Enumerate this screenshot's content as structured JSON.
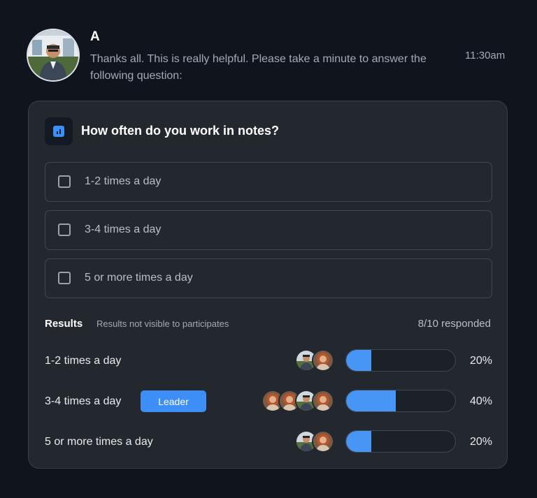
{
  "message": {
    "author": "A",
    "text": "Thanks all. This is really helpful. Please take a minute to answer the following question:",
    "time": "11:30am"
  },
  "poll": {
    "icon": "bar-chart-icon",
    "question": "How often do you work in notes?",
    "options": [
      {
        "label": "1-2 times a day",
        "checked": false
      },
      {
        "label": "3-4 times a day",
        "checked": false
      },
      {
        "label": "5 or more times a day",
        "checked": false
      }
    ],
    "results": {
      "title": "Results",
      "note": "Results not visible to participates",
      "responded": "8/10 responded",
      "leader_label": "Leader",
      "rows": [
        {
          "label": "1-2 times a day",
          "percent_text": "20%",
          "percent": 20,
          "voters": [
            "man",
            "woman"
          ],
          "leader": false
        },
        {
          "label": "3-4 times a day",
          "percent_text": "40%",
          "percent": 40,
          "voters": [
            "woman",
            "woman",
            "man",
            "woman"
          ],
          "leader": true
        },
        {
          "label": "5 or more times a day",
          "percent_text": "20%",
          "percent": 20,
          "voters": [
            "man",
            "woman"
          ],
          "leader": false
        }
      ]
    }
  },
  "colors": {
    "accent": "#3d8ef7",
    "background": "#0f141d",
    "card": "#23282f"
  }
}
